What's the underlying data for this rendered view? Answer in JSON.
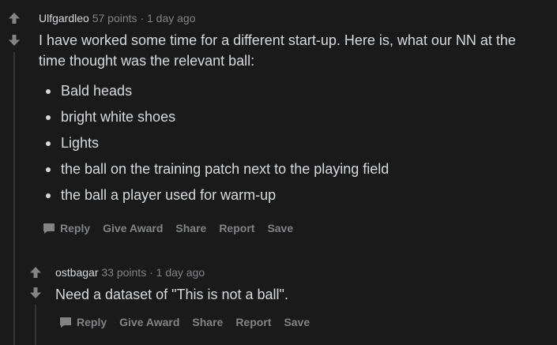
{
  "comments": [
    {
      "author": "Ulfgardleo",
      "points": "57 points",
      "separator": "·",
      "time": "1 day ago",
      "paragraph": "I have worked some time for a different start-up. Here is, what our NN at the time thought was the relevant ball:",
      "bullets": [
        "Bald heads",
        "bright white shoes",
        "Lights",
        "the ball on the training patch next to the playing field",
        "the ball a player used for warm-up"
      ],
      "actions": {
        "reply": "Reply",
        "give_award": "Give Award",
        "share": "Share",
        "report": "Report",
        "save": "Save"
      }
    },
    {
      "author": "ostbagar",
      "points": "33 points",
      "separator": "·",
      "time": "1 day ago",
      "paragraph": "Need a dataset of \"This is not a ball\".",
      "actions": {
        "reply": "Reply",
        "give_award": "Give Award",
        "share": "Share",
        "report": "Report",
        "save": "Save"
      }
    }
  ],
  "icons": {
    "upvote": "upvote-arrow-icon",
    "downvote": "downvote-arrow-icon",
    "reply": "comment-bubble-icon"
  },
  "colors": {
    "background": "#1a1a1b",
    "text": "#d7dadc",
    "muted": "#818384",
    "thread_line": "#343536"
  }
}
